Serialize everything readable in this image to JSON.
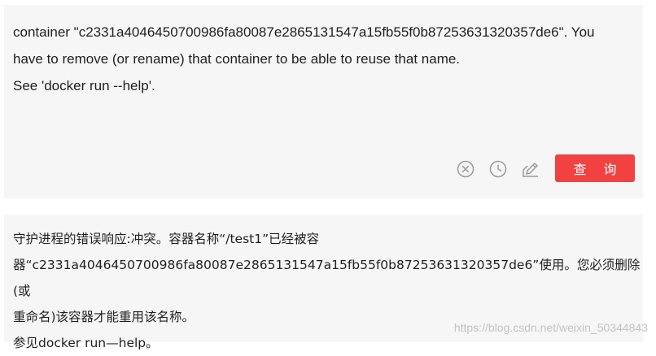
{
  "source": {
    "text": "container \"c2331a4046450700986fa80087e2865131547a15fb55f0b87253631320357de6\". You\nhave to remove (or rename) that container to be able to reuse that name.\nSee 'docker run --help'."
  },
  "toolbar": {
    "query_label": "查 询",
    "icons": [
      "clear-icon",
      "history-icon",
      "edit-icon"
    ]
  },
  "result": {
    "text": "守护进程的错误响应:冲突。容器名称“/test1”已经被容\n器“c2331a4046450700986fa80087e2865131547a15fb55f0b87253631320357de6”使用。您必须删除(或\n重命名)该容器才能重用该名称。\n参见docker run—help。"
  },
  "watermark": "https://blog.csdn.net/weixin_50344843",
  "colors": {
    "accent": "#f14141",
    "panel": "#f6f6f6",
    "icon": "#9a9a9a"
  }
}
